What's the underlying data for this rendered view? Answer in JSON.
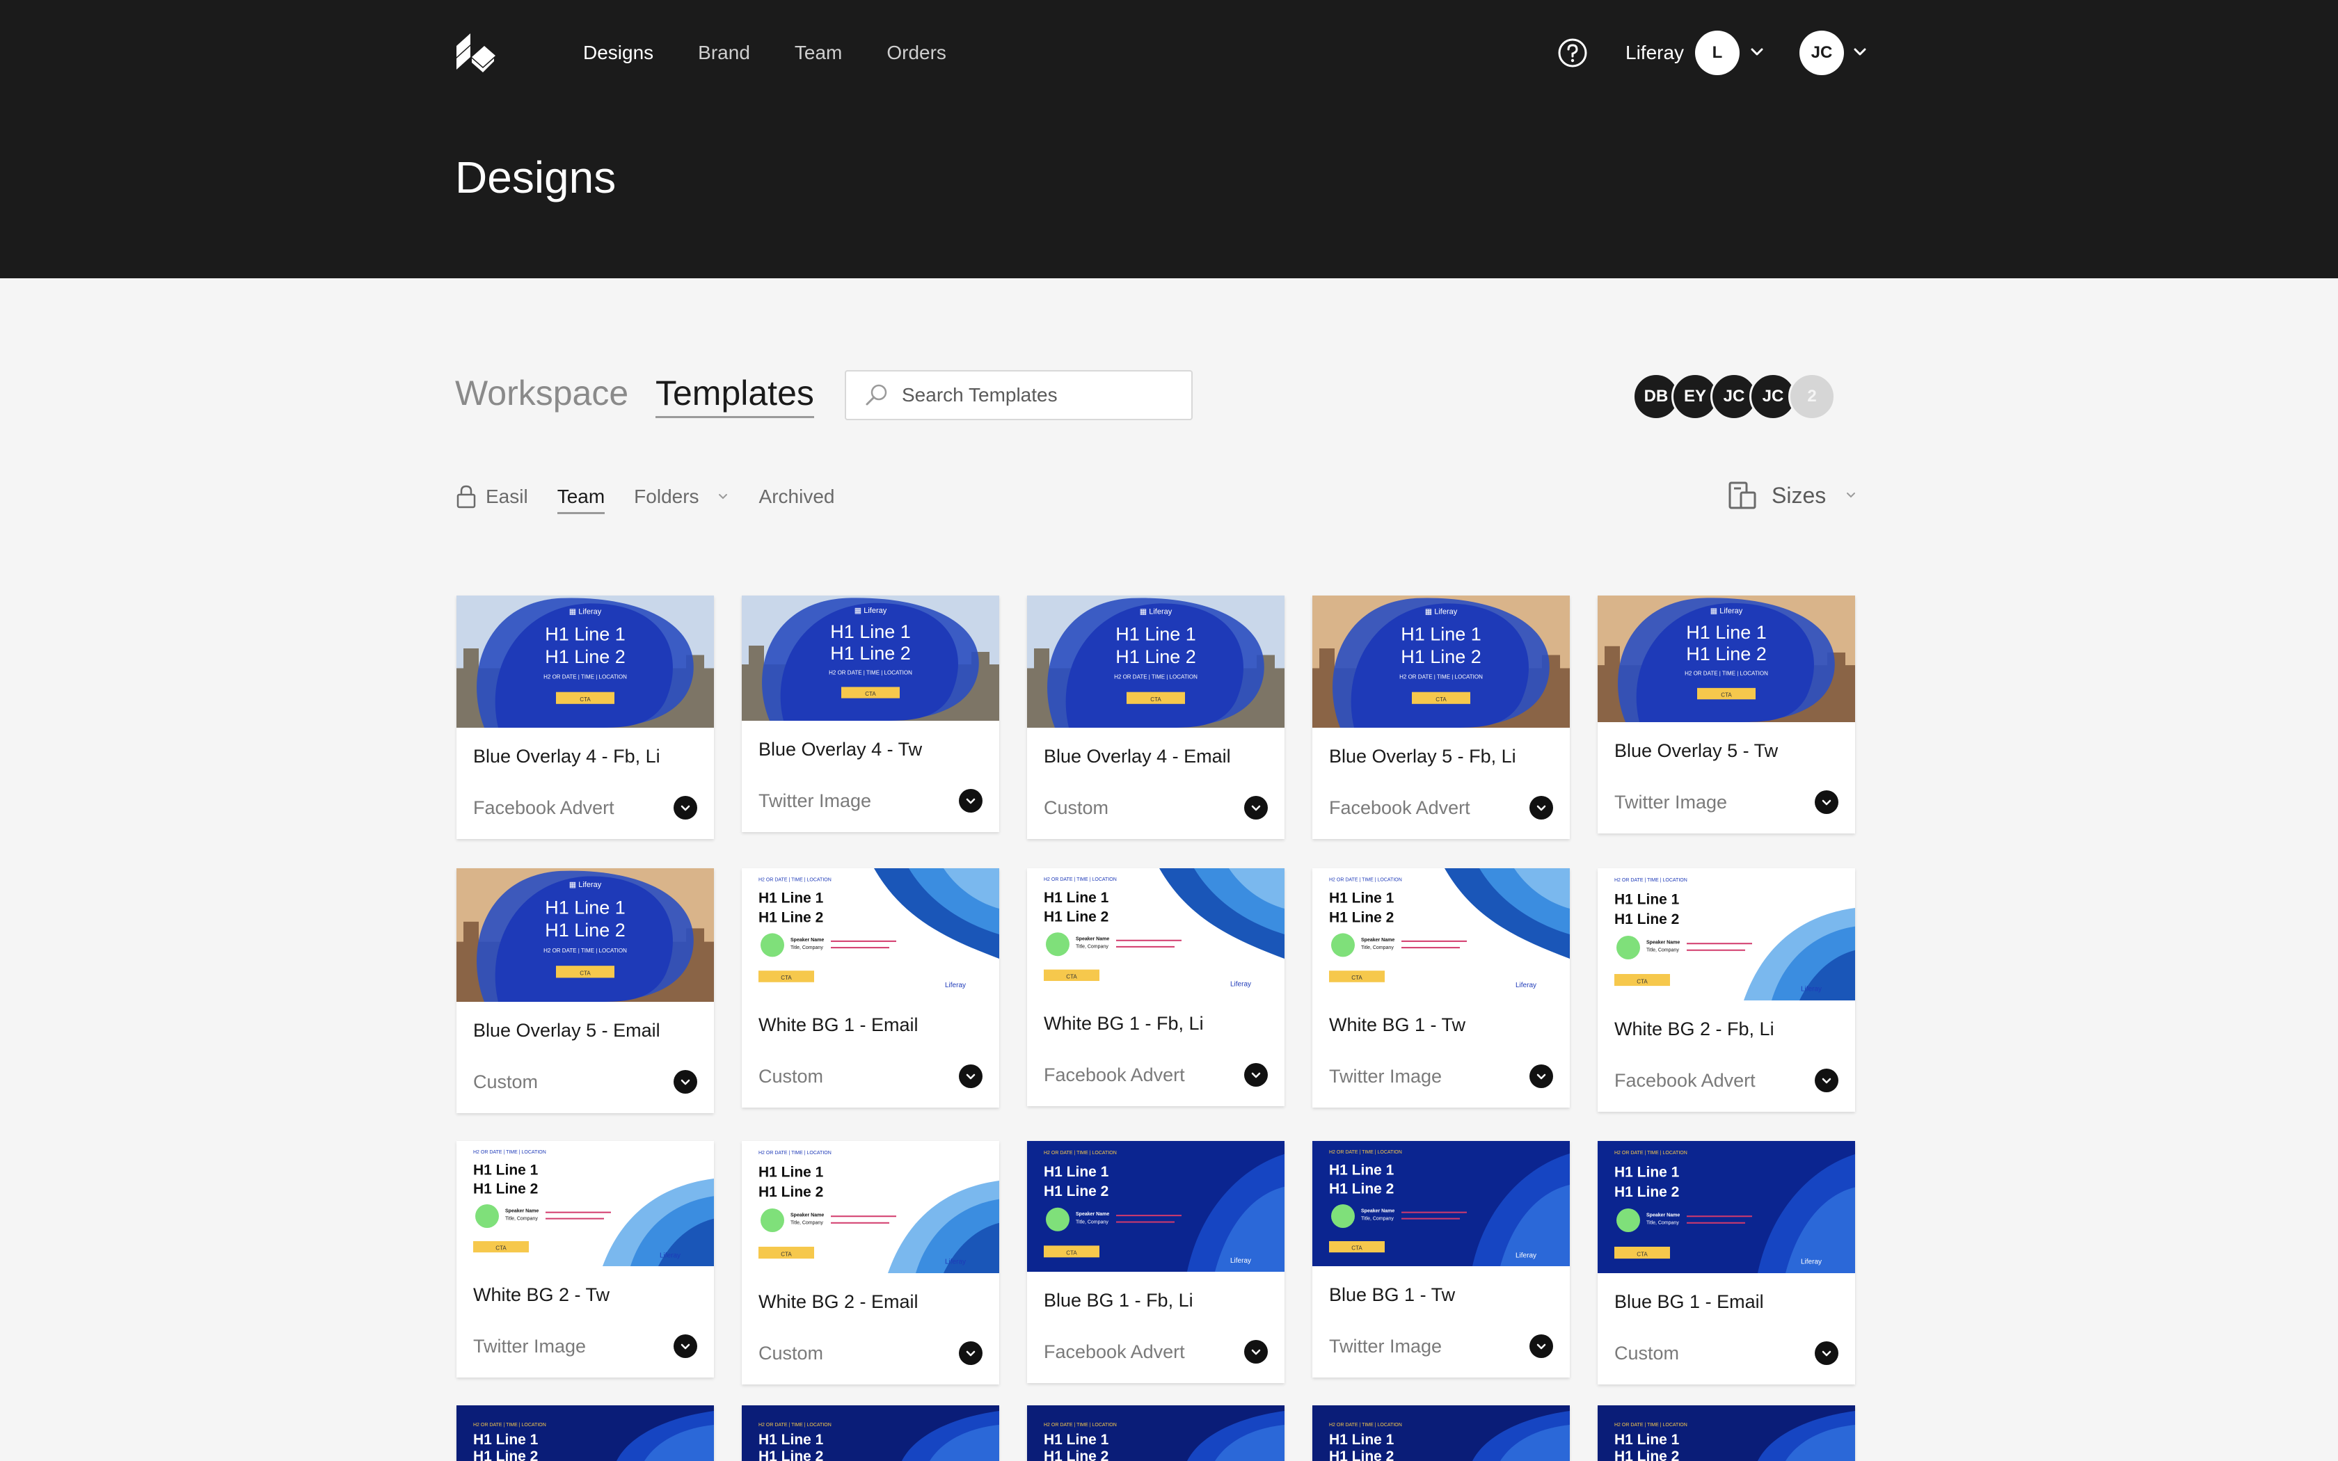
{
  "nav": {
    "items": [
      {
        "label": "Designs",
        "active": true
      },
      {
        "label": "Brand",
        "active": false
      },
      {
        "label": "Team",
        "active": false
      },
      {
        "label": "Orders",
        "active": false
      }
    ],
    "org_name": "Liferay",
    "org_avatar": "L",
    "user_avatar": "JC"
  },
  "page": {
    "title": "Designs"
  },
  "tabs": {
    "workspace": "Workspace",
    "templates": "Templates"
  },
  "search": {
    "placeholder": "Search Templates",
    "value": ""
  },
  "team_avatars": [
    "DB",
    "EY",
    "JC",
    "JC"
  ],
  "team_more_count": "2",
  "filters": {
    "easil": "Easil",
    "team": "Team",
    "folders": "Folders",
    "archived": "Archived",
    "sizes": "Sizes"
  },
  "thumbnail_text": {
    "brand": "Liferay",
    "h1_line1": "H1 Line 1",
    "h1_line2": "H1 Line 2",
    "h2": "H2 OR DATE | TIME | LOCATION",
    "cta": "CTA",
    "speaker_name": "Speaker Name",
    "speaker_title": "Title, Company"
  },
  "colors": {
    "header_bg": "#1b1b1b",
    "brand_blue": "#1e3ab8",
    "navy": "#0b1f7a",
    "cta_yellow": "#f6c84c",
    "speaker_green": "#7fe07a"
  },
  "templates": [
    {
      "title": "Blue Overlay 4 - Fb, Li",
      "type": "Facebook Advert",
      "style": "overlay-a"
    },
    {
      "title": "Blue Overlay 4 - Tw",
      "type": "Twitter Image",
      "style": "overlay-a"
    },
    {
      "title": "Blue Overlay 4 - Email",
      "type": "Custom",
      "style": "overlay-a"
    },
    {
      "title": "Blue Overlay 5 - Fb, Li",
      "type": "Facebook Advert",
      "style": "overlay-b"
    },
    {
      "title": "Blue Overlay 5 - Tw",
      "type": "Twitter Image",
      "style": "overlay-b"
    },
    {
      "title": "Blue Overlay 5 - Email",
      "type": "Custom",
      "style": "overlay-b"
    },
    {
      "title": "White BG 1 - Email",
      "type": "Custom",
      "style": "white-1"
    },
    {
      "title": "White BG 1 - Fb, Li",
      "type": "Facebook Advert",
      "style": "white-1"
    },
    {
      "title": "White BG 1 - Tw",
      "type": "Twitter Image",
      "style": "white-1"
    },
    {
      "title": "White BG 2 - Fb, Li",
      "type": "Facebook Advert",
      "style": "white-2"
    },
    {
      "title": "White BG 2 - Tw",
      "type": "Twitter Image",
      "style": "white-2"
    },
    {
      "title": "White BG 2 - Email",
      "type": "Custom",
      "style": "white-2"
    },
    {
      "title": "Blue BG 1 - Fb, Li",
      "type": "Facebook Advert",
      "style": "blue-1"
    },
    {
      "title": "Blue BG 1 - Tw",
      "type": "Twitter Image",
      "style": "blue-1"
    },
    {
      "title": "Blue BG 1 - Email",
      "type": "Custom",
      "style": "blue-1"
    },
    {
      "title": "",
      "type": "",
      "style": "blue-2"
    },
    {
      "title": "",
      "type": "",
      "style": "blue-2"
    },
    {
      "title": "",
      "type": "",
      "style": "blue-2"
    },
    {
      "title": "",
      "type": "",
      "style": "blue-2"
    },
    {
      "title": "",
      "type": "",
      "style": "blue-2"
    }
  ]
}
